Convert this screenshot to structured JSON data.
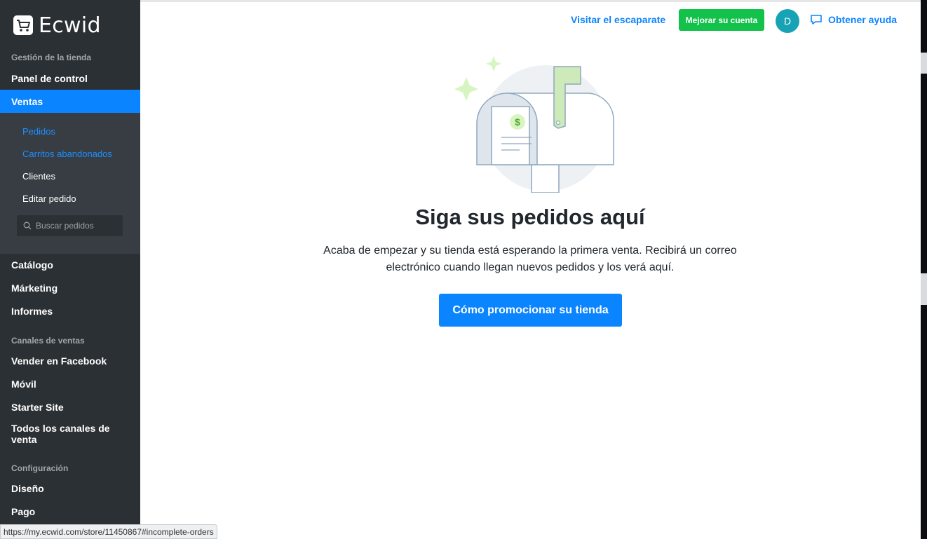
{
  "app": {
    "name": "Ecwid"
  },
  "sidebar": {
    "section_store": "Gestión de la tienda",
    "dashboard": "Panel de control",
    "sales": "Ventas",
    "sales_sub": {
      "orders": "Pedidos",
      "abandoned_carts": "Carritos abandonados",
      "customers": "Clientes",
      "edit_order": "Editar pedido"
    },
    "search": {
      "placeholder": "Buscar pedidos"
    },
    "catalog": "Catálogo",
    "marketing": "Márketing",
    "reports": "Informes",
    "section_channels": "Canales de ventas",
    "facebook": "Vender en Facebook",
    "mobile": "Móvil",
    "starter_site": "Starter Site",
    "all_channels": "Todos los canales de venta",
    "section_config": "Configuración",
    "design": "Diseño",
    "payment": "Pago"
  },
  "header": {
    "visit_store": "Visitar el escaparate",
    "upgrade": "Mejorar su cuenta",
    "avatar_initial": "D",
    "help": "Obtener ayuda"
  },
  "main": {
    "title": "Siga sus pedidos aquí",
    "description": "Acaba de empezar y su tienda está esperando la primera venta. Recibirá un correo electrónico cuando llegan nuevos pedidos y los verá aquí.",
    "cta": "Cómo promocionar su tienda",
    "illustration_symbol": "$"
  },
  "status_bar": {
    "url": "https://my.ecwid.com/store/11450867#incomplete-orders"
  },
  "colors": {
    "sidebar_bg": "#2b3034",
    "accent_blue": "#0b84ff",
    "upgrade_green": "#13c24b",
    "avatar_teal": "#17a3b5"
  }
}
